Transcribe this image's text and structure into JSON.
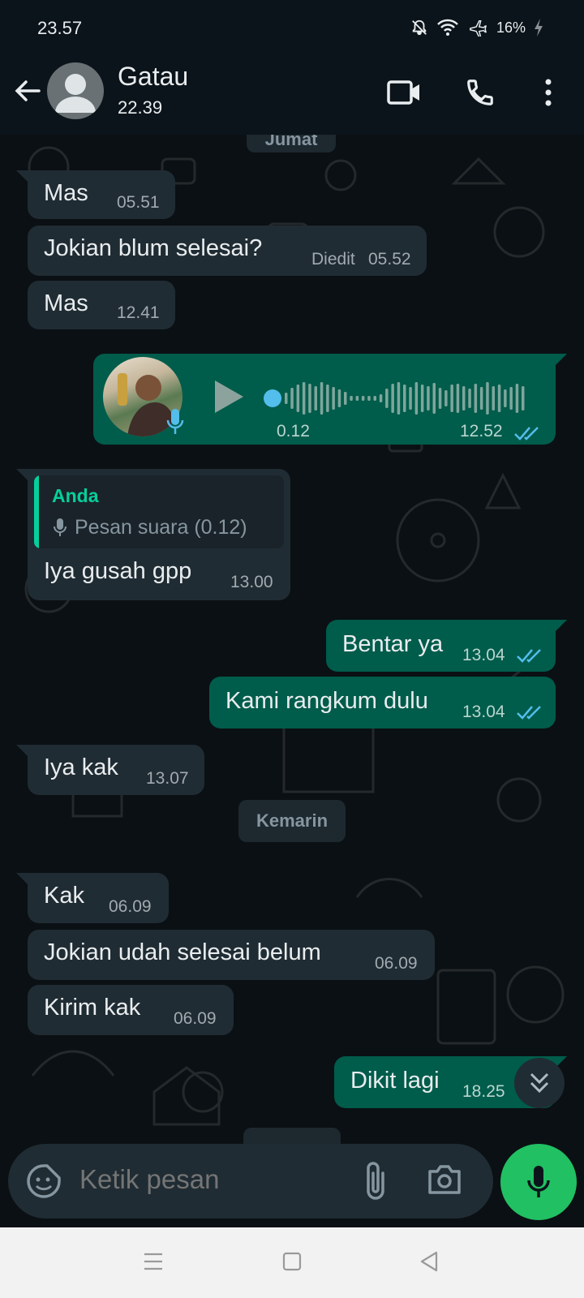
{
  "status_bar": {
    "time": "23.57",
    "battery": "16%"
  },
  "header": {
    "contact_name": "Gatau",
    "subtitle": "22.39"
  },
  "day_chips": {
    "top": "Jumat",
    "middle": "Kemarin"
  },
  "messages": [
    {
      "dir": "in",
      "text": "Mas",
      "time": "05.51"
    },
    {
      "dir": "in",
      "text": "Jokian blum selesai?",
      "edited": "Diedit",
      "time": "05.52"
    },
    {
      "dir": "in",
      "text": "Mas",
      "time": "12.41"
    },
    {
      "dir": "out",
      "type": "voice",
      "duration": "0.12",
      "time": "12.52",
      "progress": 0.0
    },
    {
      "dir": "in",
      "reply_author": "Anda",
      "reply_text": "Pesan suara (0.12)",
      "text": "Iya gusah gpp",
      "time": "13.00"
    },
    {
      "dir": "out",
      "text": "Bentar ya",
      "time": "13.04"
    },
    {
      "dir": "out",
      "text": "Kami rangkum dulu",
      "time": "13.04"
    },
    {
      "dir": "in",
      "text": "Iya kak",
      "time": "13.07"
    },
    {
      "dir": "in",
      "text": "Kak",
      "time": "06.09"
    },
    {
      "dir": "in",
      "text": "Jokian udah selesai belum",
      "time": "06.09"
    },
    {
      "dir": "in",
      "text": "Kirim kak",
      "time": "06.09"
    },
    {
      "dir": "out",
      "text": "Dikit lagi",
      "time": "18.25"
    }
  ],
  "composer": {
    "placeholder": "Ketik pesan"
  },
  "colors": {
    "incoming": "#202c33",
    "outgoing": "#005c4b",
    "accent": "#21c063",
    "read_tick": "#53bdeb",
    "reply_author": "#06cf9c"
  }
}
